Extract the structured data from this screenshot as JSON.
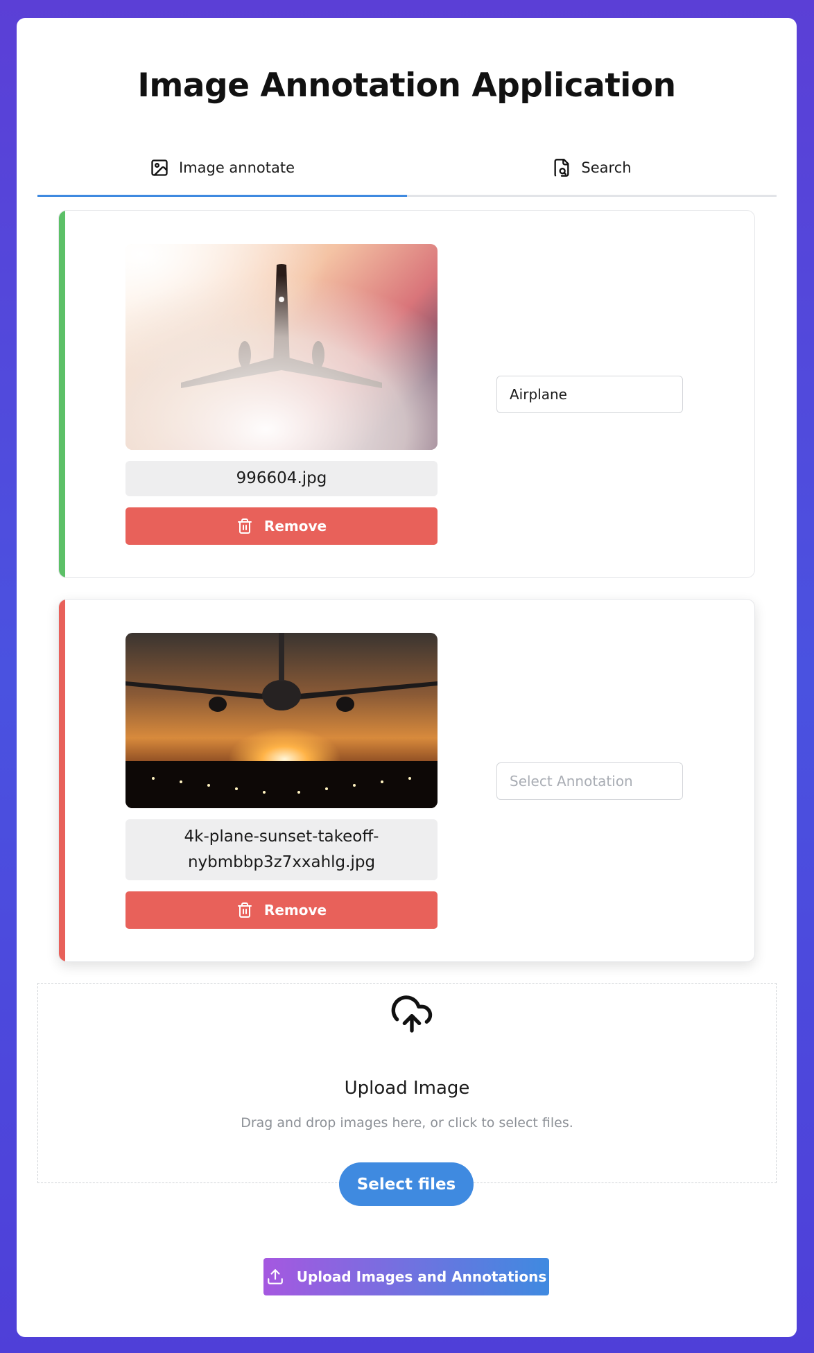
{
  "app": {
    "title": "Image Annotation Application"
  },
  "tabs": [
    {
      "label": "Image annotate",
      "icon": "image-icon",
      "active": true
    },
    {
      "label": "Search",
      "icon": "file-search-icon",
      "active": false
    }
  ],
  "images": [
    {
      "filename": "996604.jpg",
      "remove_label": "Remove",
      "annotation_value": "Airplane",
      "annotation_placeholder": "Select Annotation",
      "status_color": "#5cc067"
    },
    {
      "filename": "4k-plane-sunset-takeoff-nybmbbp3z7xxahlg.jpg",
      "remove_label": "Remove",
      "annotation_value": "",
      "annotation_placeholder": "Select Annotation",
      "status_color": "#ee7a3c"
    }
  ],
  "upload": {
    "icon": "cloud-upload-icon",
    "title": "Upload Image",
    "subtitle": "Drag and drop images here, or click to select files.",
    "select_button": "Select files"
  },
  "submit": {
    "label": "Upload Images and Annotations",
    "icon": "upload-icon"
  },
  "colors": {
    "accent": "#3f8ae0",
    "danger": "#e8615a",
    "gradient_start": "#a558e0"
  }
}
